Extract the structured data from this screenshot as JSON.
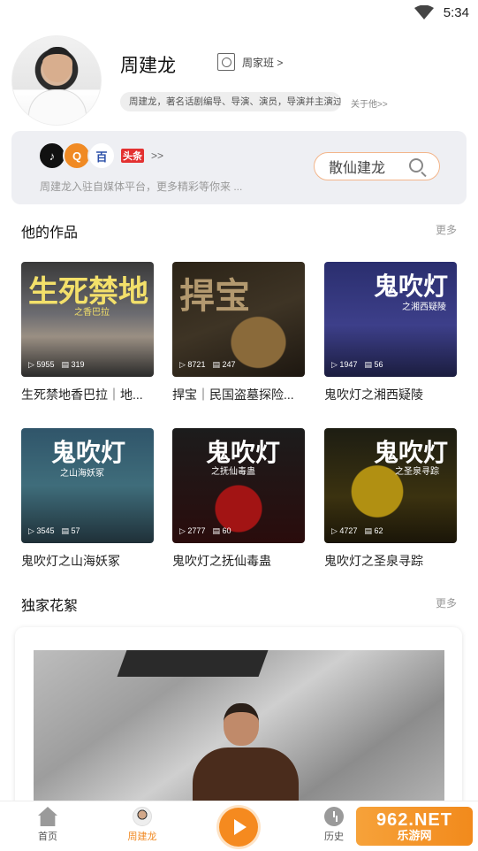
{
  "status_bar": {
    "time": "5:34"
  },
  "profile": {
    "name": "周建龙",
    "class_link": "周家班 >",
    "bio": "周建龙，著名话剧编导、导演、演员，导演并主演过...",
    "about": "关于他>>"
  },
  "media": {
    "platforms": [
      {
        "name": "tiktok",
        "glyph": "♪"
      },
      {
        "name": "qiyi",
        "glyph": "Q"
      },
      {
        "name": "baidu",
        "glyph": "百"
      },
      {
        "name": "toutiao",
        "glyph": "头条"
      }
    ],
    "chevron": ">>",
    "description": "周建龙入驻自媒体平台，更多精彩等你来 ...",
    "search_text": "散仙建龙"
  },
  "works_section": {
    "title": "他的作品",
    "more": "更多"
  },
  "works": [
    {
      "title": "生死禁地香巴拉｜地...",
      "cover_art": "生死禁地",
      "cover_sub": "之香巴拉",
      "plays": "5955",
      "episodes": "319"
    },
    {
      "title": "捍宝｜民国盗墓探险...",
      "cover_art": "捍宝",
      "cover_sub": "",
      "plays": "8721",
      "episodes": "247"
    },
    {
      "title": "鬼吹灯之湘西疑陵",
      "cover_art": "鬼吹灯",
      "cover_sub": "之湘西疑陵",
      "plays": "1947",
      "episodes": "56"
    },
    {
      "title": "鬼吹灯之山海妖冢",
      "cover_art": "鬼吹灯",
      "cover_sub": "之山海妖冢",
      "plays": "3545",
      "episodes": "57"
    },
    {
      "title": "鬼吹灯之抚仙毒蛊",
      "cover_art": "鬼吹灯",
      "cover_sub": "之抚仙毒蛊",
      "plays": "2777",
      "episodes": "60"
    },
    {
      "title": "鬼吹灯之圣泉寻踪",
      "cover_art": "鬼吹灯",
      "cover_sub": "之圣泉寻踪",
      "plays": "4727",
      "episodes": "62"
    }
  ],
  "clips_section": {
    "title": "独家花絮",
    "more": "更多"
  },
  "tabbar": {
    "home": "首页",
    "me": "周建龙",
    "history": "历史"
  },
  "watermark": {
    "big": "962.NET",
    "small": "乐游网"
  },
  "colors": {
    "accent": "#f58a1f",
    "background": "#ffffff",
    "card": "#eeeff3"
  }
}
